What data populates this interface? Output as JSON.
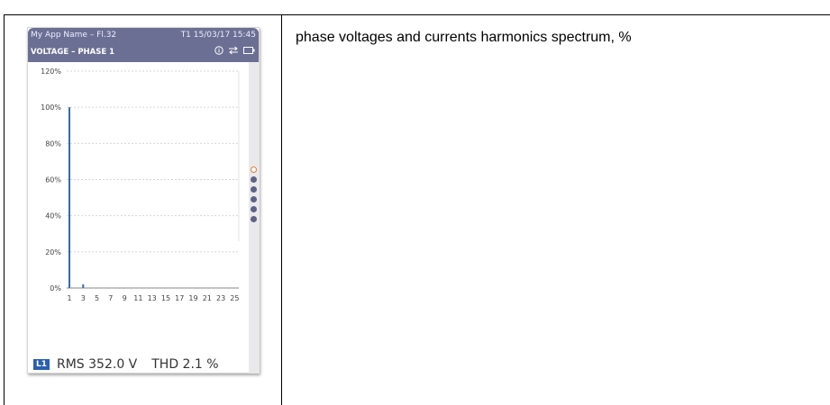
{
  "device": {
    "app_name": "My App Name – Fl.32",
    "datetime": "T1  15/03/17 15:45",
    "screen_title": "VOLTAGE – PHASE 1",
    "icons": [
      "info-icon",
      "swap-icon",
      "battery-icon"
    ],
    "pager": {
      "count": 6,
      "active_index": 0
    },
    "footer": {
      "phase_badge": "L1",
      "rms": "RMS 352.0 V",
      "thd": "THD 2.1 %"
    }
  },
  "chart_data": {
    "type": "bar",
    "title": "",
    "xlabel": "",
    "ylabel": "",
    "ylim": [
      0,
      120
    ],
    "yticks": [
      "0%",
      "20%",
      "40%",
      "60%",
      "80%",
      "100%",
      "120%"
    ],
    "x_tick_labels": [
      "1",
      "3",
      "5",
      "7",
      "9",
      "11",
      "13",
      "15",
      "17",
      "19",
      "21",
      "23",
      "25"
    ],
    "categories": [
      "1",
      "2",
      "3",
      "4",
      "5",
      "6",
      "7",
      "8",
      "9",
      "10",
      "11",
      "12",
      "13",
      "14",
      "15",
      "16",
      "17",
      "18",
      "19",
      "20",
      "21",
      "22",
      "23",
      "24",
      "25"
    ],
    "values": [
      100,
      0,
      2,
      0,
      0,
      0,
      0,
      0,
      0,
      0,
      0,
      0,
      0,
      0,
      0,
      0,
      0,
      0,
      0,
      0,
      0,
      0,
      0,
      0,
      0
    ],
    "bar_color": "#3a66b5",
    "grid": true
  },
  "document": {
    "description": "phase voltages and currents harmonics spectrum, %"
  }
}
